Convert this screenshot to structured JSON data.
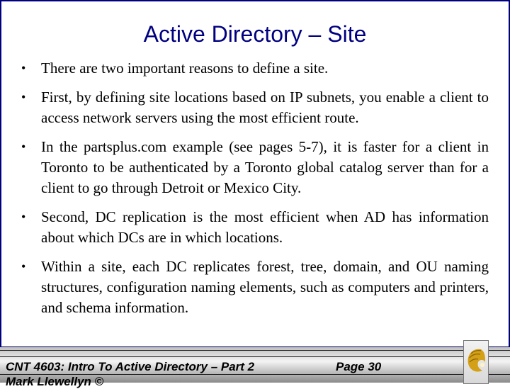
{
  "slide": {
    "title": "Active Directory – Site",
    "bullets": [
      "There are two important reasons to define a site.",
      "First, by defining site locations based on IP subnets, you enable a client to access network servers using the most efficient route.",
      "In the partsplus.com example (see pages 5-7), it is faster for a client in Toronto to be authenticated by a Toronto global catalog server than for a client to go through Detroit or Mexico City.",
      "Second, DC replication is the most efficient when AD has information about which DCs are in which locations.",
      "Within a site, each DC replicates forest, tree, domain, and OU naming structures, configuration naming elements, such as computers and printers, and schema information."
    ],
    "bullet_glyph": "•"
  },
  "footer": {
    "course": "CNT 4603: Intro To Active Directory – Part 2",
    "page": "Page 30",
    "author": "Mark Llewellyn ©",
    "logo": "ucf-pegasus-logo"
  },
  "colors": {
    "title": "#000080",
    "border": "#000080",
    "logo_gold": "#d4a017"
  }
}
